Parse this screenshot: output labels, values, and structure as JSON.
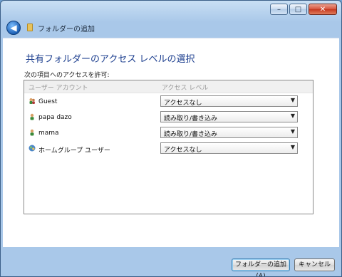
{
  "window": {
    "minimize_glyph": "–",
    "maximize_glyph": "□",
    "close_glyph": "✕"
  },
  "nav": {
    "back_glyph": "◀",
    "title": "フォルダーの追加"
  },
  "main": {
    "heading": "共有フォルダーのアクセス レベルの選択",
    "allow_label": "次の項目へのアクセスを許可:",
    "columns": [
      "ユーザー アカウント",
      "アクセス レベル"
    ],
    "rows": [
      {
        "name": "Guest",
        "access": "アクセスなし",
        "icon": "guest-user-icon"
      },
      {
        "name": "papa dazo",
        "access": "読み取り/書き込み",
        "icon": "user-icon"
      },
      {
        "name": "mama",
        "access": "読み取り/書き込み",
        "icon": "user-icon"
      },
      {
        "name": "ホームグループ ユーザー",
        "access": "アクセスなし",
        "icon": "homegroup-icon"
      }
    ],
    "dropdown_arrow": "▼"
  },
  "footer": {
    "add_button": "フォルダーの追加(A)",
    "cancel_button": "キャンセル"
  }
}
